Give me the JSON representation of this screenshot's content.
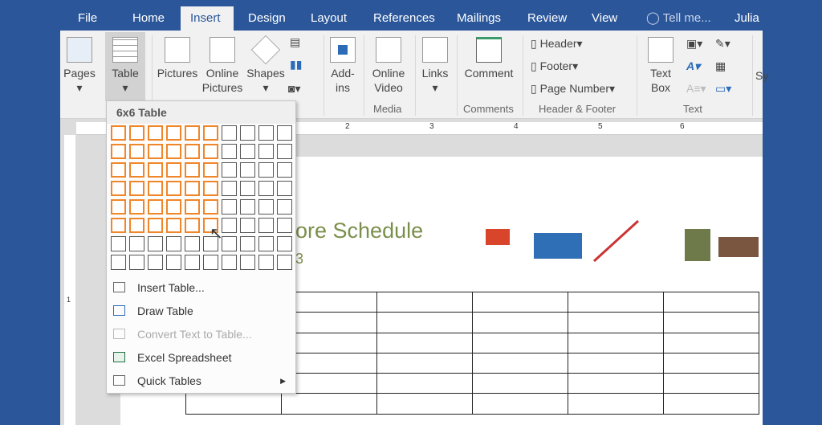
{
  "tabs": [
    "File",
    "Home",
    "Insert",
    "Design",
    "Layout",
    "References",
    "Mailings",
    "Review",
    "View"
  ],
  "active_tab": "Insert",
  "tell_me": "Tell me...",
  "user": "Julia",
  "ribbon": {
    "pages": "Pages",
    "table": "Table",
    "pictures": "Pictures",
    "online_pictures": "Online Pictures",
    "shapes": "Shapes",
    "addins": "Add-ins",
    "online_video": "Online Video",
    "links": "Links",
    "comment": "Comment",
    "header": "Header",
    "footer": "Footer",
    "page_number": "Page Number",
    "text_box": "Text Box",
    "sy": "Sy",
    "groups": {
      "media": "Media",
      "comments": "Comments",
      "header_footer": "Header & Footer",
      "text": "Text"
    }
  },
  "table_menu": {
    "header": "6x6 Table",
    "grid": {
      "cols": 10,
      "rows": 8,
      "selected_cols": 6,
      "selected_rows": 6
    },
    "highlight_color": "#f0862a",
    "items": [
      {
        "label": "Insert Table...",
        "enabled": true
      },
      {
        "label": "Draw Table",
        "enabled": true
      },
      {
        "label": "Convert Text to Table...",
        "enabled": false
      },
      {
        "label": "Excel Spreadsheet",
        "enabled": true
      },
      {
        "label": "Quick Tables",
        "enabled": true,
        "submenu": true
      }
    ]
  },
  "document": {
    "title": "ore Schedule",
    "subtitle": "3",
    "title_color": "#7a8f4b",
    "table": {
      "rows": 6,
      "cols": 6
    }
  },
  "ruler_numbers": [
    "1",
    "2",
    "3",
    "4",
    "5",
    "6"
  ],
  "colors": {
    "brand": "#2b579a"
  }
}
